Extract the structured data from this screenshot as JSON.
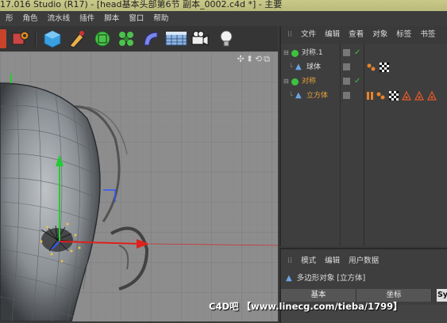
{
  "window": {
    "title": "17.016 Studio (R17) - [head基本头部第6节 副本_0002.c4d *] - 主要"
  },
  "menu": {
    "items": [
      "形",
      "角色",
      "流水线",
      "插件",
      "脚本",
      "窗口",
      "帮助"
    ]
  },
  "toolbar": {
    "icons": [
      "render-settings-icon",
      "cube-primitive-icon",
      "pen-spline-icon",
      "subdivision-generator-icon",
      "cloner-array-icon",
      "deformer-bend-icon",
      "floor-environment-icon",
      "camera-icon",
      "light-bulb-icon"
    ]
  },
  "viewport": {
    "nav_icons": "✣⬍⟲⧉"
  },
  "object_manager": {
    "menu": [
      "文件",
      "编辑",
      "查看",
      "对象",
      "标签",
      "书签"
    ],
    "rows": [
      {
        "name": "对称.1",
        "color": "#dddddd"
      },
      {
        "name": "球体",
        "color": "#dddddd"
      },
      {
        "name": "对称",
        "color": "#e8a23a"
      },
      {
        "name": "立方体",
        "color": "#e8a23a"
      }
    ]
  },
  "attribute_manager": {
    "menu": [
      "模式",
      "编辑",
      "用户数据"
    ],
    "object_label": "多边形对象 [立方体]",
    "tabs": [
      "基本",
      "坐标",
      "Sy"
    ]
  },
  "watermark": {
    "text": "C4D吧 【www.linecg.com/tieba/1799】"
  },
  "colors": {
    "accent": "#e8a23a",
    "axis_x": "#e0201c",
    "axis_y": "#22cc33",
    "axis_z": "#3355ff"
  }
}
